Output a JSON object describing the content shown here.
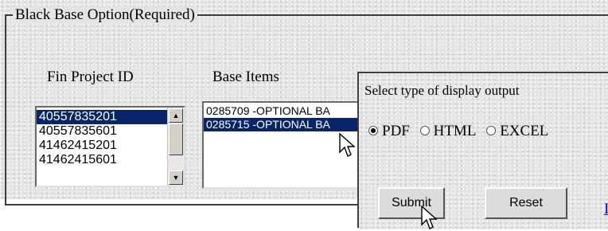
{
  "form": {
    "legend": "Black Base Option(Required)",
    "fin_project": {
      "title": "Fin Project ID",
      "items": [
        "40557835201",
        "40557835601",
        "41462415201",
        "41462415601"
      ],
      "selected_index": 0
    },
    "base_items": {
      "title": "Base Items",
      "items": [
        "0285709 -OPTIONAL BA",
        "0285715 -OPTIONAL BA"
      ],
      "selected_index": 1
    }
  },
  "output_dialog": {
    "title": "Select type of display output",
    "options": [
      "PDF",
      "HTML",
      "EXCEL"
    ],
    "selected_option": "PDF",
    "submit_label": "Submit",
    "reset_label": "Reset",
    "link_fragment": "I"
  },
  "icons": {
    "scroll_up": "scroll-up-arrow-icon",
    "scroll_down": "scroll-down-arrow-icon",
    "cursor": "mouse-pointer-icon"
  },
  "colors": {
    "selection": "#0a246a",
    "link": "#0000ee"
  }
}
